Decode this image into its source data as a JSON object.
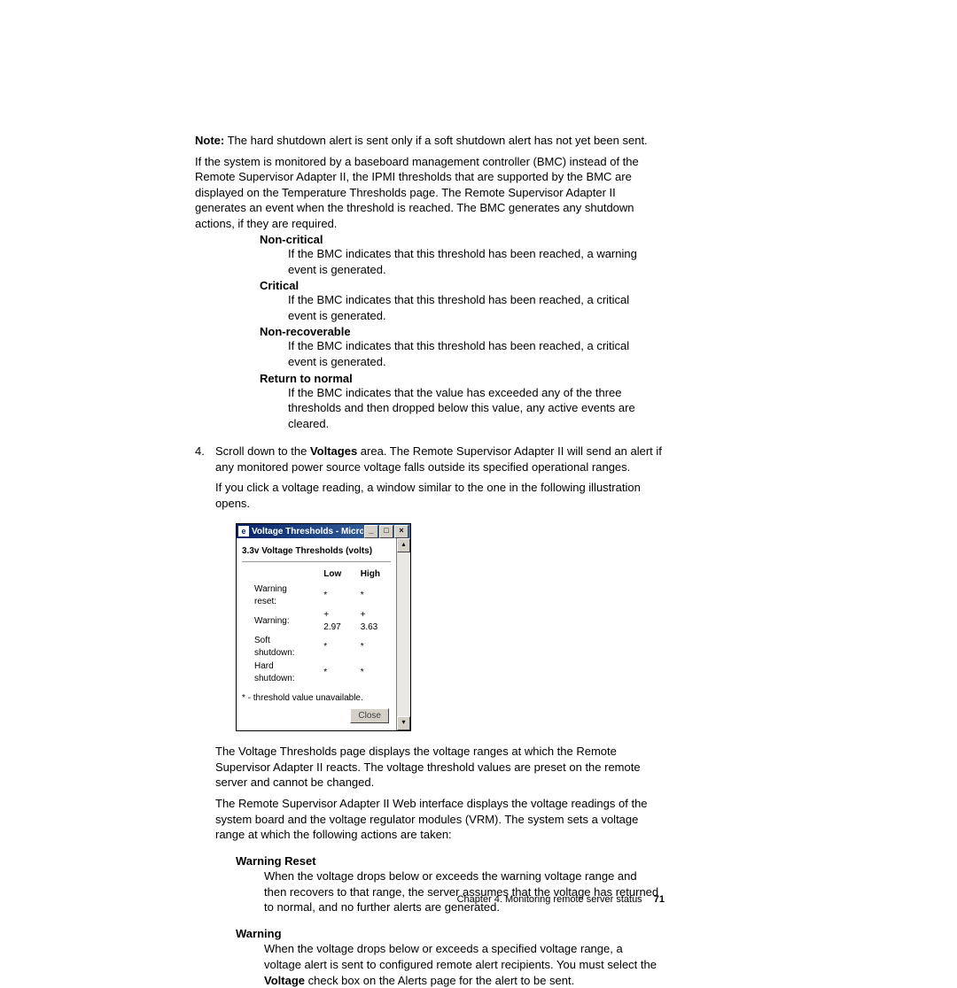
{
  "note": {
    "label": "Note:",
    "text": "The hard shutdown alert is sent only if a soft shutdown alert has not yet been sent."
  },
  "bmc_para": "If the system is monitored by a baseboard management controller (BMC) instead of the Remote Supervisor Adapter II, the IPMI thresholds that are supported by the BMC are displayed on the Temperature Thresholds page. The Remote Supervisor Adapter II generates an event when the threshold is reached. The BMC generates any shutdown actions, if they are required.",
  "defs": {
    "noncritical": {
      "term": "Non-critical",
      "def": "If the BMC indicates that this threshold has been reached, a warning event is generated."
    },
    "critical": {
      "term": "Critical",
      "def": "If the BMC indicates that this threshold has been reached, a critical event is generated."
    },
    "nonrecoverable": {
      "term": "Non-recoverable",
      "def": "If the BMC indicates that this threshold has been reached, a critical event is generated."
    },
    "returnnormal": {
      "term": "Return to normal",
      "def": "If the BMC indicates that the value has exceeded any of the three thresholds and then dropped below this value, any active events are cleared."
    }
  },
  "step4": {
    "num": "4.",
    "lead": "Scroll down to the ",
    "bold": "Voltages",
    "tail": " area. The Remote Supervisor Adapter II will send an alert if any monitored power source voltage falls outside its specified operational ranges.",
    "para2": "If you click a voltage reading, a window similar to the one in the following illustration opens."
  },
  "dialog": {
    "title": "Voltage Thresholds - Microsoft Intern...",
    "heading": "3.3v Voltage Thresholds (volts)",
    "cols": {
      "low": "Low",
      "high": "High"
    },
    "rows": [
      {
        "label": "Warning reset:",
        "low": "*",
        "high": "*"
      },
      {
        "label": "Warning:",
        "low": "+ 2.97",
        "high": "+ 3.63"
      },
      {
        "label": "Soft shutdown:",
        "low": "*",
        "high": "*"
      },
      {
        "label": "Hard shutdown:",
        "low": "*",
        "high": "*"
      }
    ],
    "footnote": "* - threshold value unavailable.",
    "close": "Close"
  },
  "after_dialog": {
    "p1": "The Voltage Thresholds page displays the voltage ranges at which the Remote Supervisor Adapter II reacts. The voltage threshold values are preset on the remote server and cannot be changed.",
    "p2": "The Remote Supervisor Adapter II Web interface displays the voltage readings of the system board and the voltage regulator modules (VRM). The system sets a voltage range at which the following actions are taken:"
  },
  "defs2": {
    "warningreset": {
      "term": "Warning Reset",
      "def": "When the voltage drops below or exceeds the warning voltage range and then recovers to that range, the server assumes that the voltage has returned to normal, and no further alerts are generated."
    },
    "warning": {
      "term": "Warning",
      "def_pre": "When the voltage drops below or exceeds a specified voltage range, a voltage alert is sent to configured remote alert recipients. You must select the ",
      "def_bold": "Voltage",
      "def_post": " check box on the Alerts page for the alert to be sent."
    }
  },
  "footer": {
    "chapter": "Chapter 4. Monitoring remote server status",
    "page": "71"
  }
}
